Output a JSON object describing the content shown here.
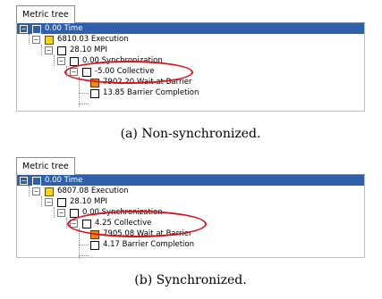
{
  "panel_a": {
    "tab_label": "Metric tree",
    "rows": [
      {
        "value": "0.00",
        "label": "Time"
      },
      {
        "value": "6810.03",
        "label": "Execution"
      },
      {
        "value": "28.10",
        "label": "MPI"
      },
      {
        "value": "0.00",
        "label": "Synchronization"
      },
      {
        "value": "-5.00",
        "label": "Collective"
      },
      {
        "value": "7902.20",
        "label": "Wait at Barrier"
      },
      {
        "value": "13.85",
        "label": "Barrier Completion"
      }
    ],
    "caption": "(a)  Non-synchronized."
  },
  "panel_b": {
    "tab_label": "Metric tree",
    "rows": [
      {
        "value": "0.00",
        "label": "Time"
      },
      {
        "value": "6807.08",
        "label": "Execution"
      },
      {
        "value": "28.10",
        "label": "MPI"
      },
      {
        "value": "0.00",
        "label": "Synchronization"
      },
      {
        "value": "4.25",
        "label": "Collective"
      },
      {
        "value": "7905.08",
        "label": "Wait at Barrier"
      },
      {
        "value": "4.17",
        "label": "Barrier Completion"
      }
    ],
    "caption": "(b)  Synchronized."
  },
  "colors": {
    "selection": "#2f5fa9",
    "highlight_ellipse": "#d9141c",
    "execution_box": "#f7d116",
    "wait_at_barrier_box": "#f08a12"
  },
  "icons": {
    "expand_toggle": "minus-box",
    "metric_marker": "square-box"
  }
}
